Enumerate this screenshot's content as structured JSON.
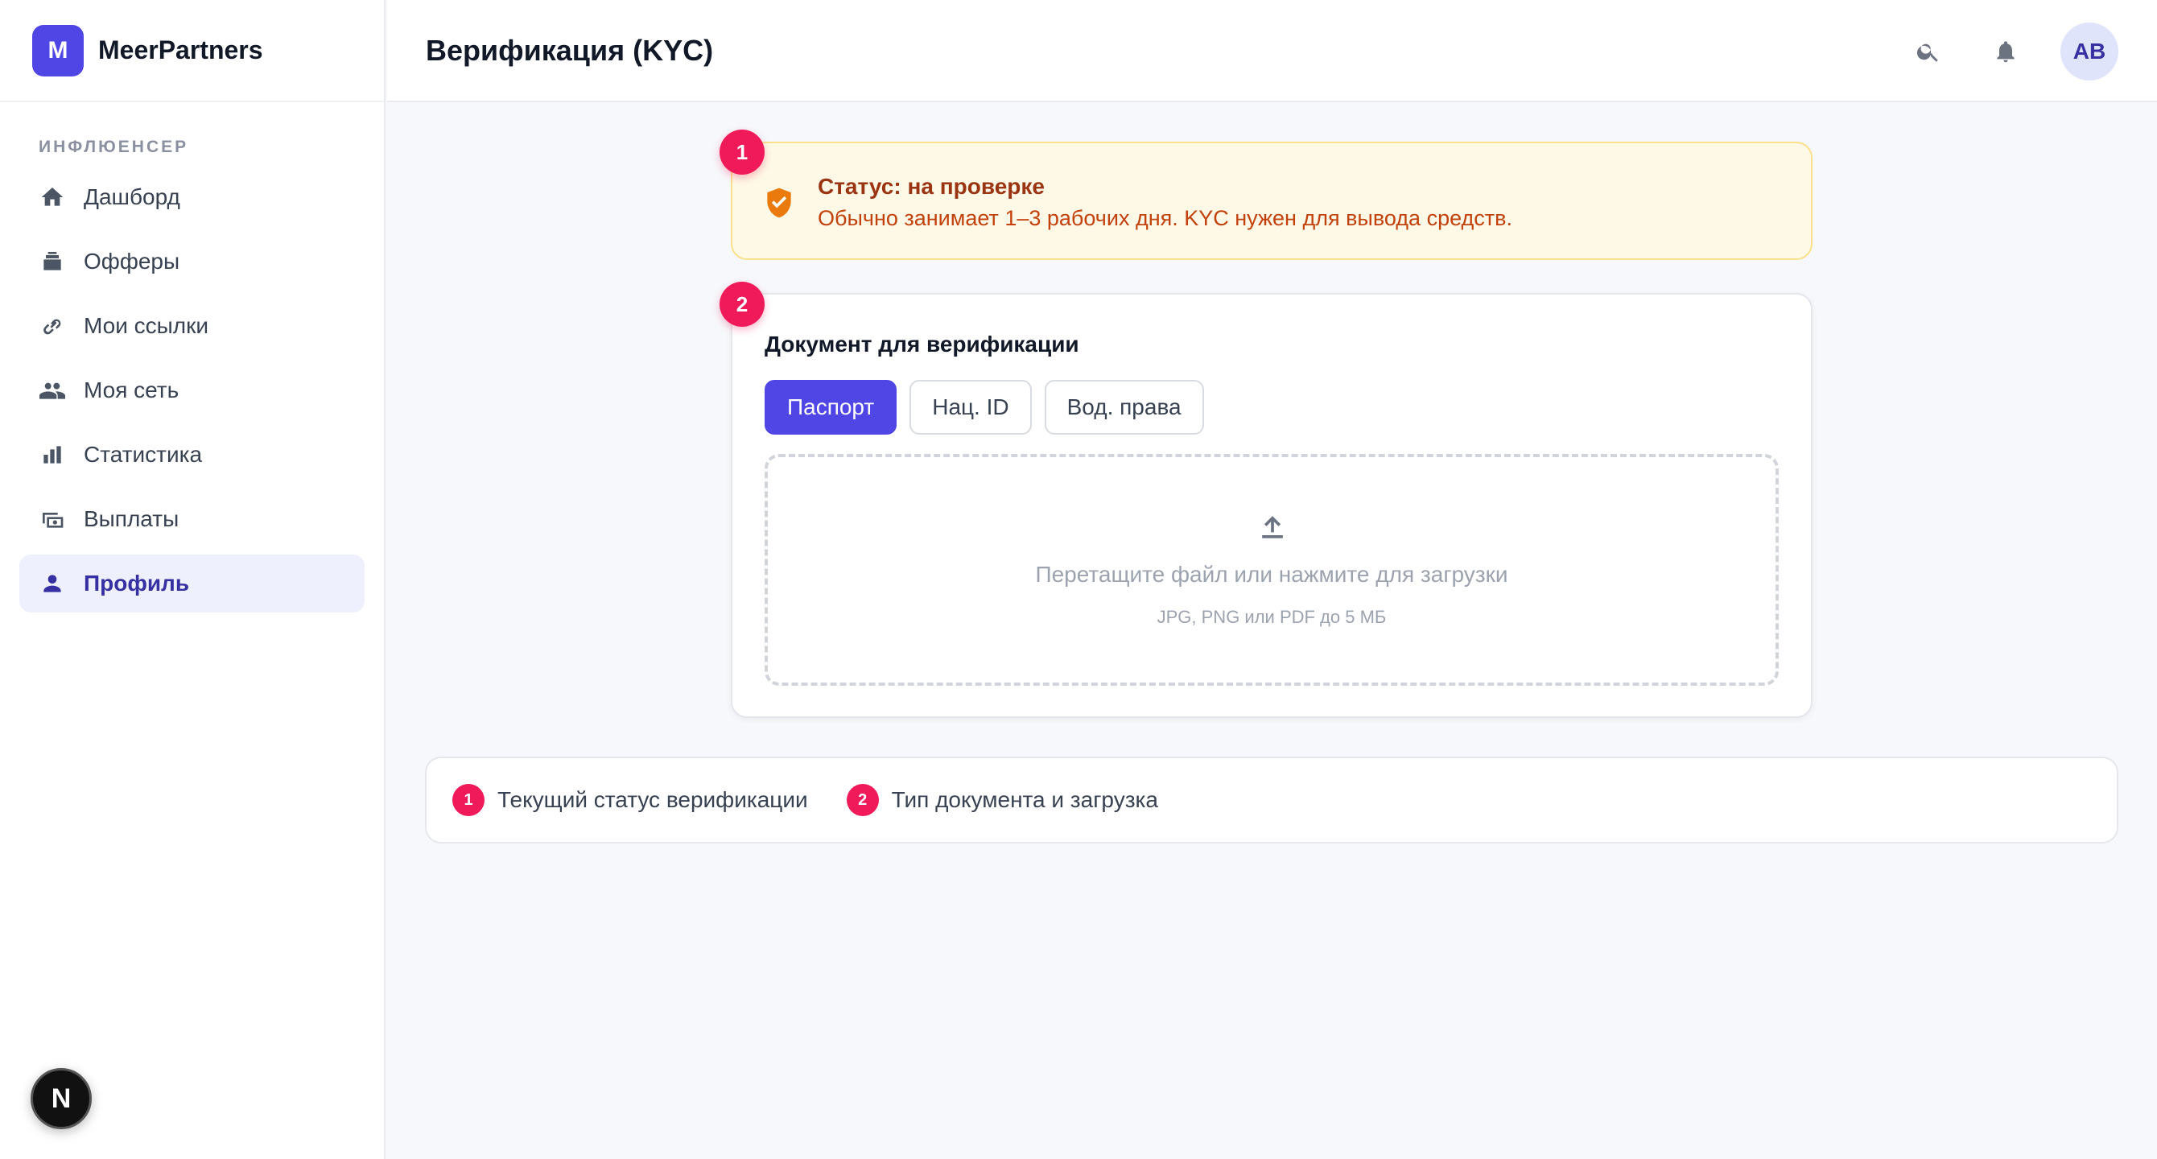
{
  "brand": {
    "logo_letter": "M",
    "name": "MeerPartners",
    "accent": "#4f46e5"
  },
  "sidebar": {
    "section_label": "ИНФЛЮЕНСЕР",
    "items": [
      {
        "label": "Дашборд",
        "icon": "home-icon"
      },
      {
        "label": "Офферы",
        "icon": "offers-icon"
      },
      {
        "label": "Мои ссылки",
        "icon": "link-icon"
      },
      {
        "label": "Моя сеть",
        "icon": "people-icon"
      },
      {
        "label": "Статистика",
        "icon": "bar-chart-icon"
      },
      {
        "label": "Выплаты",
        "icon": "payments-icon"
      },
      {
        "label": "Профиль",
        "icon": "person-icon",
        "active": true
      }
    ]
  },
  "next_badge": "N",
  "header": {
    "title": "Верификация (KYC)",
    "avatar": "AB"
  },
  "status": {
    "marker": "1",
    "title": "Статус: на проверке",
    "description": "Обычно занимает 1–3 рабочих дня. KYC нужен для вывода средств.",
    "color": "#9a3412"
  },
  "document": {
    "marker": "2",
    "title": "Документ для верификации",
    "tabs": [
      "Паспорт",
      "Нац. ID",
      "Вод. права"
    ],
    "active_tab": "Паспорт",
    "dropzone": {
      "main": "Перетащите файл или нажмите для загрузки",
      "sub": "JPG, PNG или PDF до 5 МБ"
    }
  },
  "legend": [
    {
      "num": "1",
      "text": "Текущий статус верификации"
    },
    {
      "num": "2",
      "text": "Тип документа и загрузка"
    }
  ],
  "marker_color": "#f0195a"
}
